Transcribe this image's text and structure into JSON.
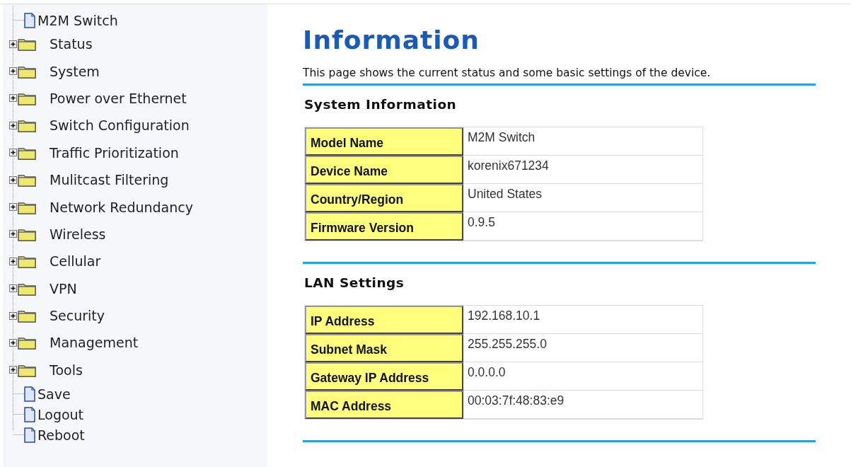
{
  "sidebar": {
    "items": [
      {
        "kind": "page",
        "label": "M2M Switch"
      },
      {
        "kind": "folder",
        "label": "Status",
        "expanded": false
      },
      {
        "kind": "folder",
        "label": "System",
        "expanded": false
      },
      {
        "kind": "folder",
        "label": "Power over Ethernet",
        "expanded": false
      },
      {
        "kind": "folder",
        "label": "Switch Configuration",
        "expanded": false
      },
      {
        "kind": "folder",
        "label": "Traffic Prioritization",
        "expanded": false
      },
      {
        "kind": "folder",
        "label": "Mulitcast Filtering",
        "expanded": false
      },
      {
        "kind": "folder",
        "label": "Network Redundancy",
        "expanded": false
      },
      {
        "kind": "folder",
        "label": "Wireless",
        "expanded": false
      },
      {
        "kind": "folder",
        "label": "Cellular",
        "expanded": false
      },
      {
        "kind": "folder",
        "label": "VPN",
        "expanded": false
      },
      {
        "kind": "folder",
        "label": "Security",
        "expanded": false
      },
      {
        "kind": "folder",
        "label": "Management",
        "expanded": false
      },
      {
        "kind": "folder",
        "label": "Tools",
        "expanded": false
      },
      {
        "kind": "page",
        "label": "Save"
      },
      {
        "kind": "page",
        "label": "Logout"
      },
      {
        "kind": "page",
        "label": "Reboot"
      }
    ]
  },
  "page": {
    "title": "Information",
    "description": "This page shows the current status and some basic settings of the device.",
    "sections": [
      {
        "heading": "System Information",
        "rows": [
          {
            "label": "Model Name",
            "value": "M2M Switch"
          },
          {
            "label": "Device Name",
            "value": "korenix671234"
          },
          {
            "label": "Country/Region",
            "value": "United States"
          },
          {
            "label": "Firmware Version",
            "value": "0.9.5"
          }
        ]
      },
      {
        "heading": "LAN Settings",
        "rows": [
          {
            "label": "IP Address",
            "value": "192.168.10.1"
          },
          {
            "label": "Subnet Mask",
            "value": "255.255.255.0"
          },
          {
            "label": "Gateway IP Address",
            "value": "0.0.0.0"
          },
          {
            "label": "MAC Address",
            "value": "00:03:7f:48:83:e9"
          }
        ]
      }
    ]
  }
}
